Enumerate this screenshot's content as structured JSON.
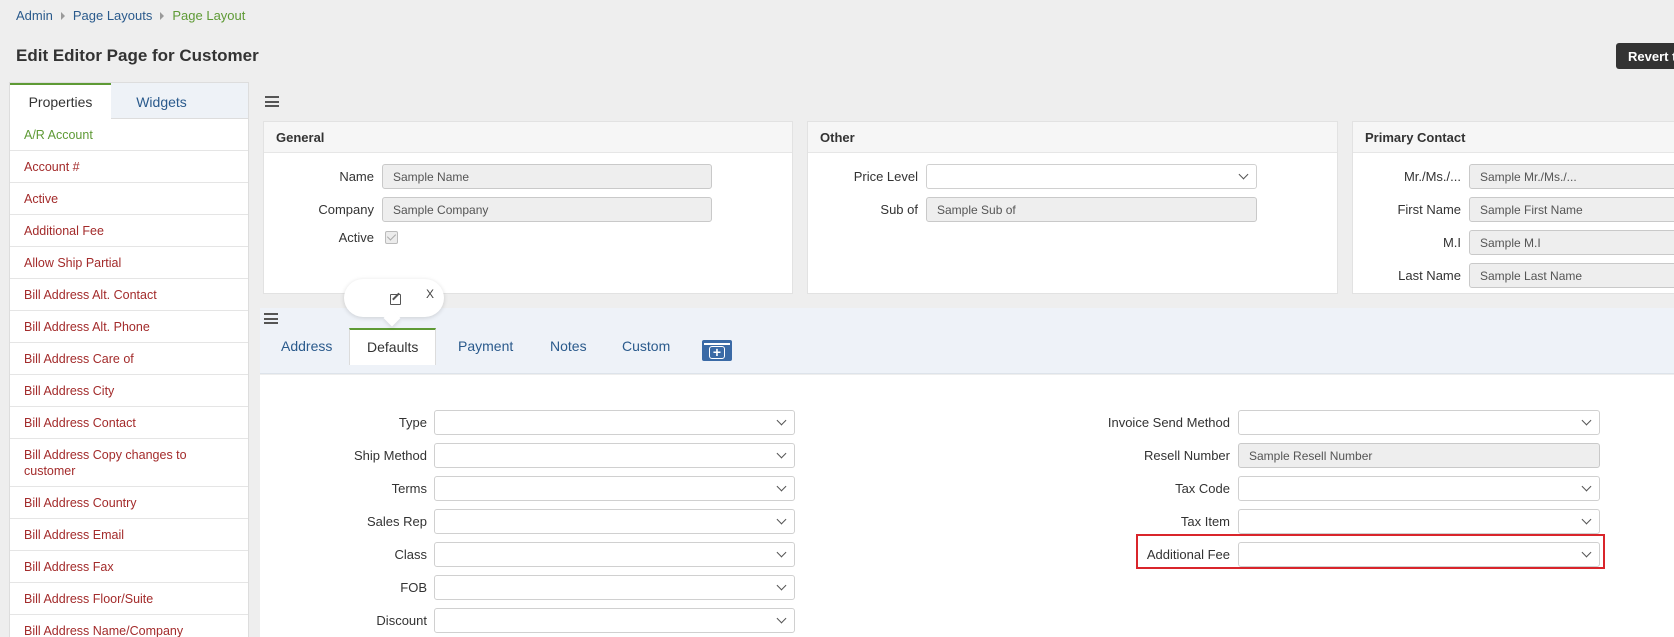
{
  "breadcrumb": {
    "items": [
      "Admin",
      "Page Layouts"
    ],
    "current": "Page Layout"
  },
  "page_title": "Edit Editor Page for Customer",
  "revert_label": "Revert t",
  "left_tabs": [
    "Properties",
    "Widgets"
  ],
  "properties": [
    "A/R Account",
    "Account #",
    "Active",
    "Additional Fee",
    "Allow Ship Partial",
    "Bill Address Alt. Contact",
    "Bill Address Alt. Phone",
    "Bill Address Care of",
    "Bill Address City",
    "Bill Address Contact",
    "Bill Address Copy changes to customer",
    "Bill Address Country",
    "Bill Address Email",
    "Bill Address Fax",
    "Bill Address Floor/Suite",
    "Bill Address Name/Company"
  ],
  "general": {
    "title": "General",
    "name_label": "Name",
    "name_value": "Sample Name",
    "company_label": "Company",
    "company_value": "Sample Company",
    "active_label": "Active"
  },
  "other": {
    "title": "Other",
    "price_level_label": "Price Level",
    "sub_of_label": "Sub of",
    "sub_of_value": "Sample Sub of"
  },
  "primary_contact": {
    "title": "Primary Contact",
    "mr_label": "Mr./Ms./...",
    "mr_value": "Sample Mr./Ms./...",
    "first_label": "First Name",
    "first_value": "Sample First Name",
    "mi_label": "M.I",
    "mi_value": "Sample M.I",
    "last_label": "Last Name",
    "last_value": "Sample Last Name"
  },
  "popover": {
    "close": "X"
  },
  "bottom_tabs": [
    "Address",
    "Defaults",
    "Payment",
    "Notes",
    "Custom"
  ],
  "defaults_left": [
    "Type",
    "Ship Method",
    "Terms",
    "Sales Rep",
    "Class",
    "FOB",
    "Discount"
  ],
  "defaults_right": {
    "invoice_send_method": "Invoice Send Method",
    "resell_number_label": "Resell Number",
    "resell_number_value": "Sample Resell Number",
    "tax_code": "Tax Code",
    "tax_item": "Tax Item",
    "additional_fee": "Additional Fee"
  },
  "colors": {
    "link": "#2a5a8c",
    "accent": "#5e9a35",
    "property": "#a32b2b",
    "highlight": "#d9252b"
  }
}
